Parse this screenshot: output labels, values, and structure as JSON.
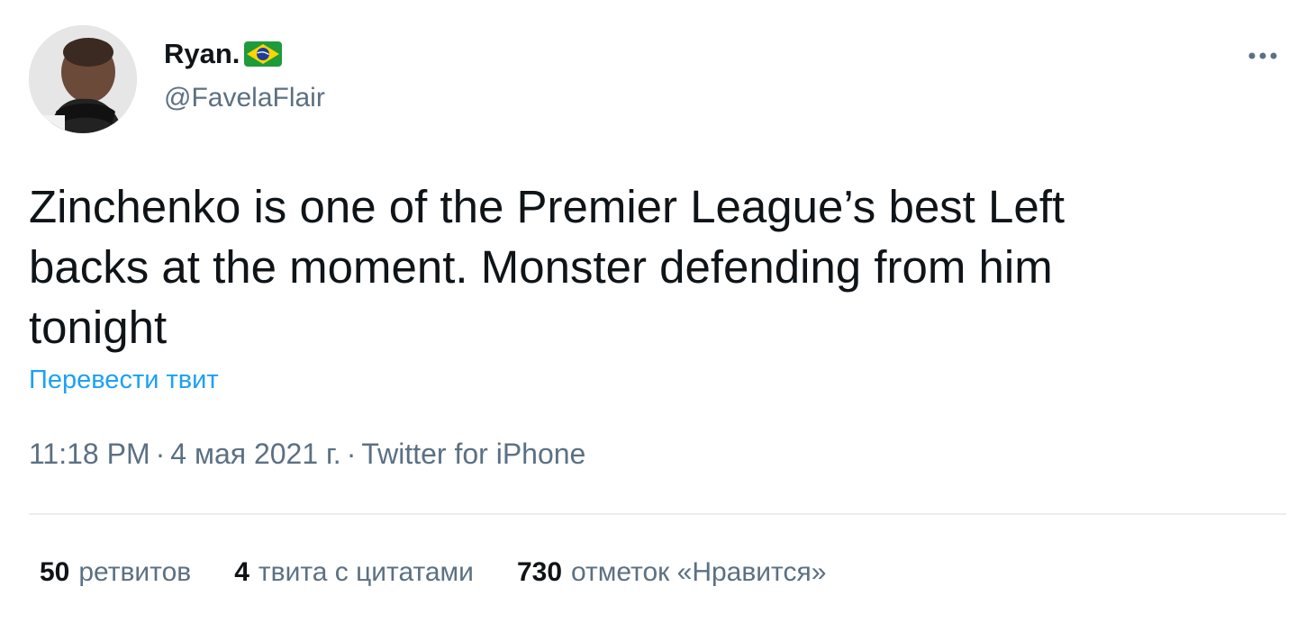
{
  "author": {
    "display_name": "Ryan.",
    "flag_icon": "brazil-flag-icon",
    "handle": "@FavelaFlair",
    "avatar_icon": "user-avatar"
  },
  "menu": {
    "icon": "more-dots-icon"
  },
  "tweet": {
    "text": "Zinchenko is one of the Premier League’s best Left\nbacks at the moment. Monster defending from him\ntonight",
    "translate_label": "Перевести твит",
    "time": "11:18 PM",
    "date": "4 мая 2021 г.",
    "separator": "·",
    "source": "Twitter for iPhone"
  },
  "stats": [
    {
      "count": "50",
      "label": "ретвитов"
    },
    {
      "count": "4",
      "label": "твита с цитатами"
    },
    {
      "count": "730",
      "label": "отметок «Нравится»"
    }
  ],
  "colors": {
    "text_primary": "#0f1419",
    "text_secondary": "#5b7083",
    "link": "#1da1f2",
    "divider": "#ebeef0"
  }
}
